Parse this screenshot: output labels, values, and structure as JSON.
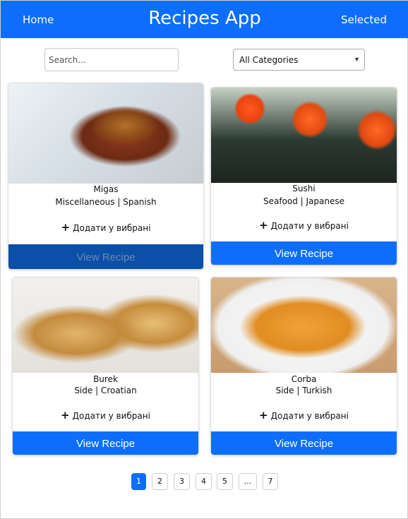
{
  "header": {
    "home_label": "Home",
    "title": "Recipes App",
    "selected_label": "Selected"
  },
  "search": {
    "placeholder": "Search...",
    "value": ""
  },
  "category_select": {
    "selected": "All Categories"
  },
  "recipes": [
    {
      "name": "Migas",
      "meta": "Miscellaneous | Spanish",
      "fav_label": "Додати у вибрані",
      "button_label": "View Recipe"
    },
    {
      "name": "Sushi",
      "meta": "Seafood | Japanese",
      "fav_label": "Додати у вибрані",
      "button_label": "View Recipe"
    },
    {
      "name": "Burek",
      "meta": "Side | Croatian",
      "fav_label": "Додати у вибрані",
      "button_label": "View Recipe"
    },
    {
      "name": "Corba",
      "meta": "Side | Turkish",
      "fav_label": "Додати у вибрані",
      "button_label": "View Recipe"
    }
  ],
  "pagination": {
    "pages": [
      "1",
      "2",
      "3",
      "4",
      "5",
      "...",
      "7"
    ],
    "current": "1"
  },
  "colors": {
    "primary": "#0d6efd",
    "active_button": "#0b4fa8"
  }
}
